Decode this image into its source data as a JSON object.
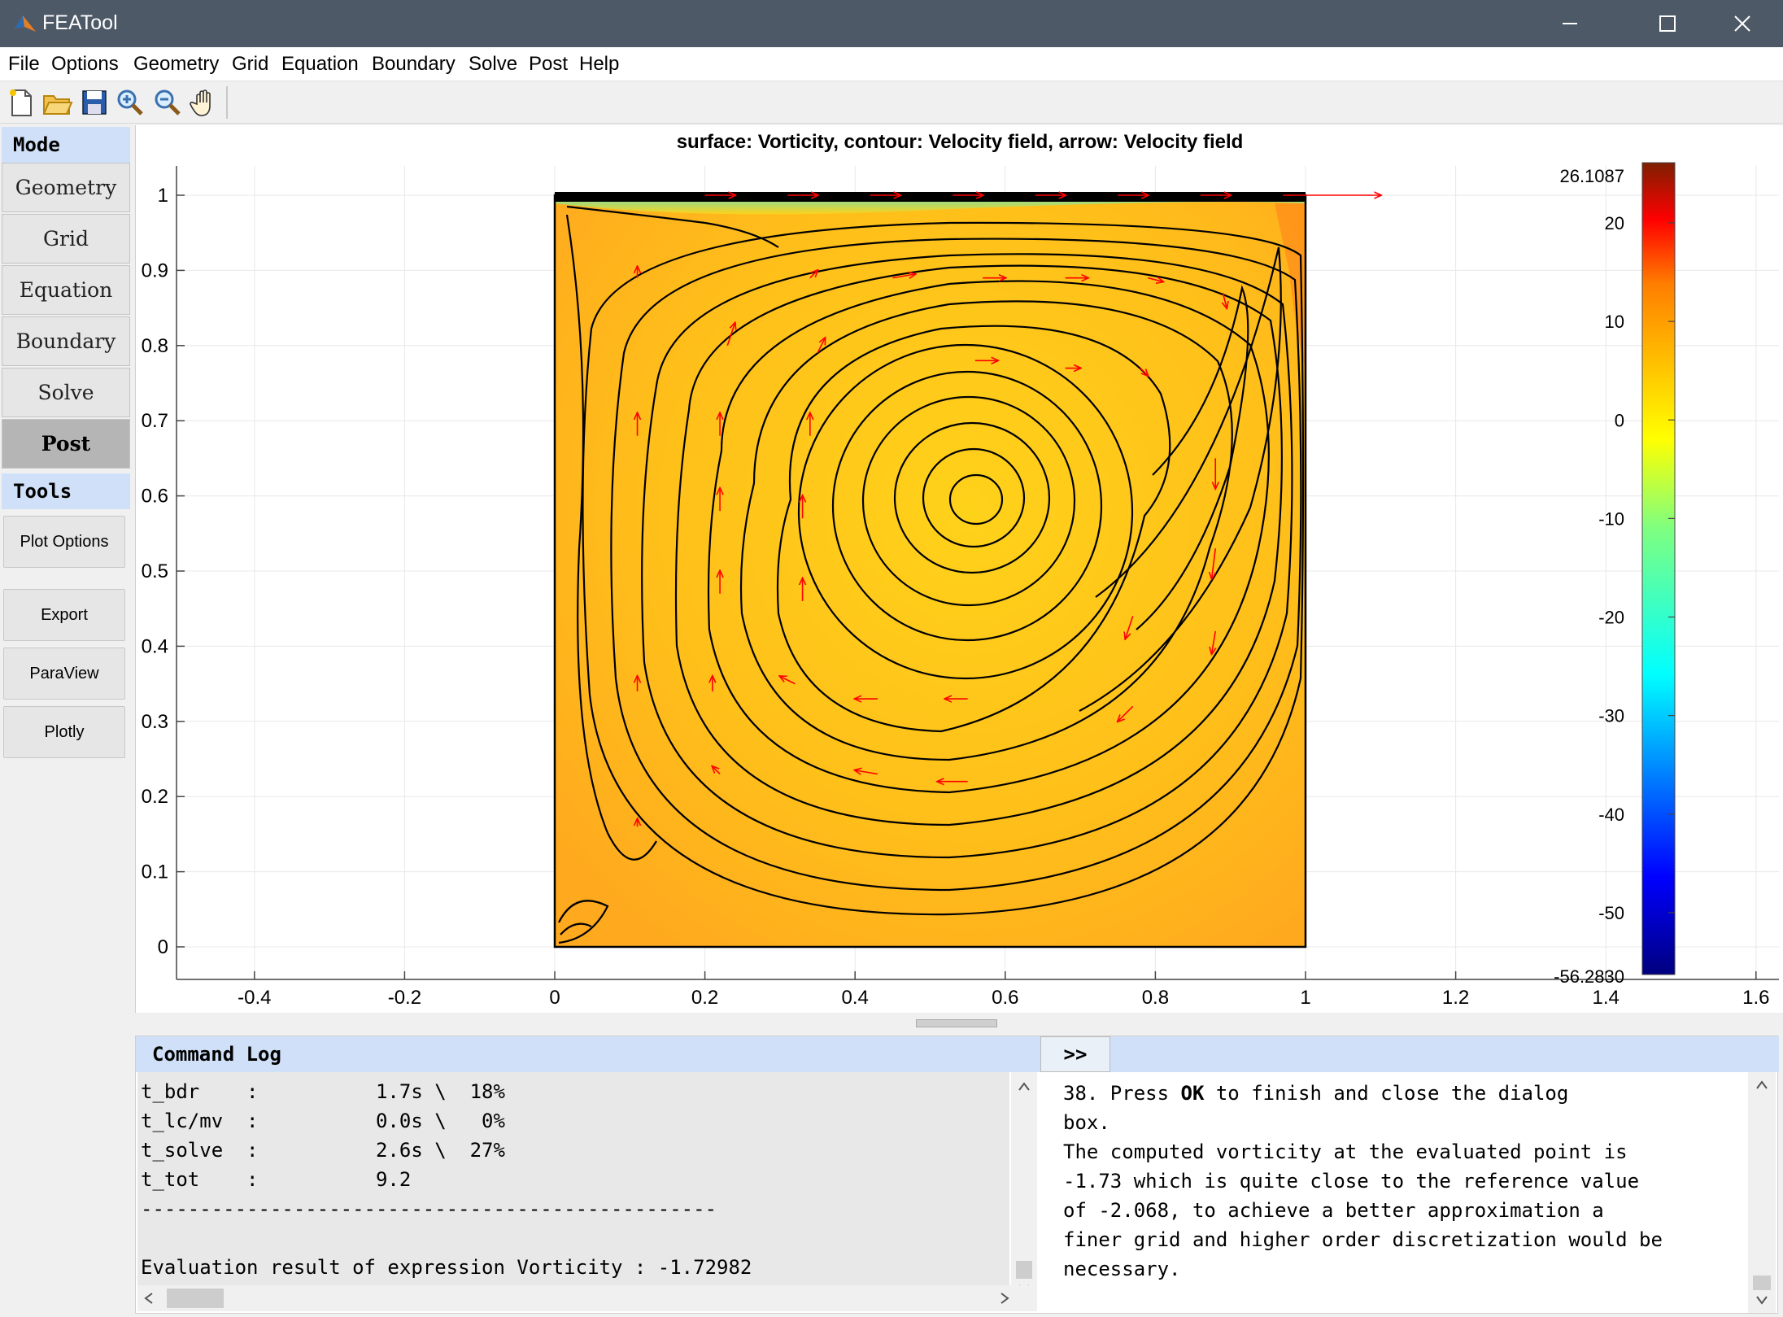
{
  "window": {
    "title": "FEATool",
    "minimize_icon": "minimize-icon",
    "maximize_icon": "maximize-icon",
    "close_icon": "close-icon"
  },
  "menu": [
    "File",
    "Options",
    "Geometry",
    "Grid",
    "Equation",
    "Boundary",
    "Solve",
    "Post",
    "Help"
  ],
  "toolbar": [
    "new-file-icon",
    "open-folder-icon",
    "save-icon",
    "zoom-in-icon",
    "zoom-out-icon",
    "pan-hand-icon"
  ],
  "sidebar": {
    "mode_header": "Mode",
    "modes": [
      "Geometry",
      "Grid",
      "Equation",
      "Boundary",
      "Solve",
      "Post"
    ],
    "active_mode": "Post",
    "tools_header": "Tools",
    "tools": [
      "Plot Options",
      "Export",
      "ParaView",
      "Plotly"
    ]
  },
  "plot": {
    "title": "surface: Vorticity, contour: Velocity field, arrow: Velocity field",
    "xticks": [
      "-0.4",
      "-0.2",
      "0",
      "0.2",
      "0.4",
      "0.6",
      "0.8",
      "1",
      "1.2",
      "1.4",
      "1.6"
    ],
    "yticks": [
      "0",
      "0.1",
      "0.2",
      "0.3",
      "0.4",
      "0.5",
      "0.6",
      "0.7",
      "0.8",
      "0.9",
      "1"
    ],
    "colorbar": {
      "max": "26.1087",
      "min": "-56.2830",
      "ticks": [
        "20",
        "10",
        "0",
        "-10",
        "-20",
        "-30",
        "-40",
        "-50"
      ]
    },
    "colors": {
      "fill": "#ffb81c",
      "contour": "#000000",
      "arrows": "#ff0000"
    }
  },
  "log": {
    "header": "Command Log",
    "lines": [
      "t_bdr    :          1.7s \\  18%",
      "t_lc/mv  :          0.0s \\   0%",
      "t_solve  :          2.6s \\  27%",
      "t_tot    :          9.2",
      "-------------------------------------------------",
      "",
      "Evaluation result of expression Vorticity : -1.72982"
    ]
  },
  "help": {
    "toggle": ">>",
    "lines": [
      "38. Press OK to finish and close the dialog",
      "box.",
      "",
      "The computed vorticity at the evaluated point is",
      "-1.73 which is quite close to the reference value",
      "of -2.068, to achieve a better approximation a",
      "finer grid and higher order discretization would be",
      "necessary."
    ]
  }
}
